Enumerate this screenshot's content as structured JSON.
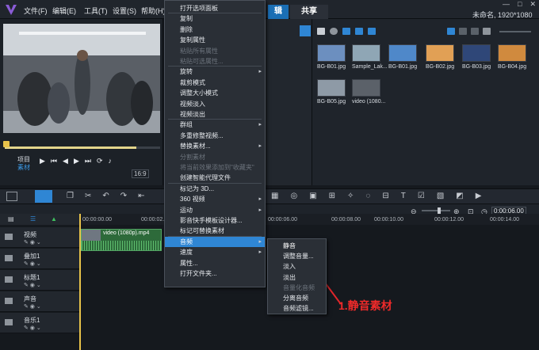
{
  "menubar": {
    "items": [
      "文件(F)",
      "编辑(E)",
      "工具(T)",
      "设置(S)",
      "帮助(H)"
    ]
  },
  "tabs": {
    "edit_partial": "辑",
    "share": "共享"
  },
  "project_info": "未命名, 1920*1080",
  "preview": {
    "project_label": "项目",
    "clip_label": "素材",
    "zoom": "16:9"
  },
  "library": {
    "thumbs": [
      {
        "label": "BG-B01.jpg",
        "color": "#6c8fbf"
      },
      {
        "label": "Sample_Lak...",
        "color": "#8fa6b5"
      },
      {
        "label": "BG-B01.jpg",
        "color": "#4f88c9"
      },
      {
        "label": "BG-B02.jpg",
        "color": "#e1a055"
      },
      {
        "label": "BG-B03.jpg",
        "color": "#2f4778"
      },
      {
        "label": "BG-B04.jpg",
        "color": "#d08a3e"
      },
      {
        "label": "BG-B05.jpg",
        "color": "#8e9aa6"
      },
      {
        "label": "video (1080...",
        "color": "#5b6169"
      }
    ]
  },
  "timeline": {
    "ruler_ticks": [
      "00:00:00.00",
      "00:00:02.0",
      "00:00:06.00",
      "00:00:08.00",
      "00:00:10.00",
      "00:00:12.00",
      "00:00:14.00"
    ],
    "timecode": "0:00:06.00",
    "tracks": [
      "视频",
      "叠加1",
      "标题1",
      "声音",
      "音乐1"
    ],
    "clip_label": "video (1080p).mp4"
  },
  "context_menu": {
    "items": [
      {
        "label": "打开选项面板",
        "disabled": false,
        "sub": false
      },
      {
        "label": "复制",
        "disabled": false,
        "sub": false
      },
      {
        "label": "删除",
        "disabled": false,
        "sub": false
      },
      {
        "label": "复制属性",
        "disabled": false,
        "sub": false
      },
      {
        "label": "粘贴所有属性",
        "disabled": true,
        "sub": false
      },
      {
        "label": "粘贴可选属性...",
        "disabled": true,
        "sub": false
      },
      {
        "label": "旋转",
        "disabled": false,
        "sub": true
      },
      {
        "label": "裁剪模式",
        "disabled": false,
        "sub": false
      },
      {
        "label": "调整大小模式",
        "disabled": false,
        "sub": false
      },
      {
        "label": "视频淡入",
        "disabled": false,
        "sub": false
      },
      {
        "label": "视频淡出",
        "disabled": false,
        "sub": false
      },
      {
        "label": "群组",
        "disabled": false,
        "sub": true
      },
      {
        "label": "多重修整视频...",
        "disabled": false,
        "sub": false
      },
      {
        "label": "替换素材...",
        "disabled": false,
        "sub": true
      },
      {
        "label": "分割素材",
        "disabled": true,
        "sub": false
      },
      {
        "label": "将当前效果添加到\"收藏夹\"",
        "disabled": true,
        "sub": false
      },
      {
        "label": "创建智能代理文件",
        "disabled": false,
        "sub": false
      },
      {
        "label": "标记为 3D...",
        "disabled": false,
        "sub": false
      },
      {
        "label": "360 视频",
        "disabled": false,
        "sub": true
      },
      {
        "label": "运动",
        "disabled": false,
        "sub": true
      },
      {
        "label": "影音快手模板设计器...",
        "disabled": false,
        "sub": false
      },
      {
        "label": "标记可替换素材",
        "disabled": false,
        "sub": false
      },
      {
        "label": "音频",
        "disabled": false,
        "sub": true
      },
      {
        "label": "速度",
        "disabled": false,
        "sub": true
      },
      {
        "label": "属性...",
        "disabled": false,
        "sub": false
      },
      {
        "label": "打开文件夹...",
        "disabled": false,
        "sub": false
      }
    ]
  },
  "submenu": {
    "items": [
      {
        "label": "静音",
        "disabled": false
      },
      {
        "label": "调整音量...",
        "disabled": false
      },
      {
        "label": "淡入",
        "disabled": false
      },
      {
        "label": "淡出",
        "disabled": false
      },
      {
        "label": "音量化音频",
        "disabled": true
      },
      {
        "label": "分离音频",
        "disabled": false
      },
      {
        "label": "音频滤镜...",
        "disabled": false
      }
    ]
  },
  "annotation": "1.静音素材",
  "colors": {
    "highlight": "#2f86d4",
    "annotation_red": "#e0262b"
  }
}
